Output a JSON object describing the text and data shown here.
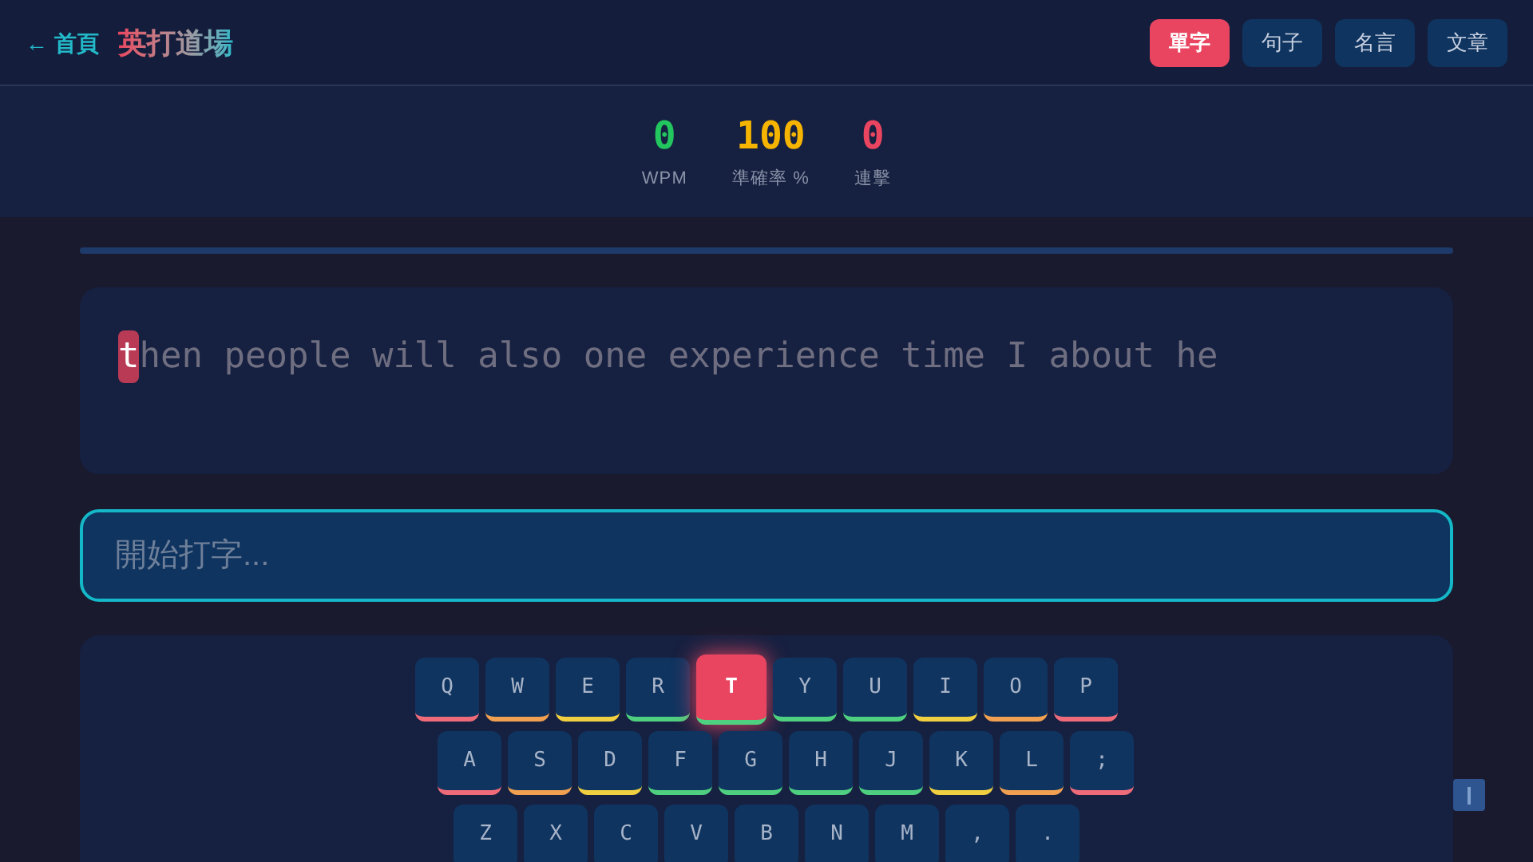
{
  "header": {
    "back_link": "← 首頁",
    "title": "英打道場",
    "modes": [
      {
        "label": "單字",
        "selected": true
      },
      {
        "label": "句子",
        "selected": false
      },
      {
        "label": "名言",
        "selected": false
      },
      {
        "label": "文章",
        "selected": false
      }
    ]
  },
  "stats": [
    {
      "value": "0",
      "label": "WPM",
      "color": "#22c55e"
    },
    {
      "value": "100",
      "label": "準確率 %",
      "color": "#f5b400"
    },
    {
      "value": "0",
      "label": "連擊",
      "color": "#e94560"
    }
  ],
  "target": {
    "current": "t",
    "rest": "hen people will also one experience time I about he"
  },
  "input": {
    "placeholder": "開始打字..."
  },
  "keyboard": {
    "rows": [
      [
        {
          "label": "Q",
          "color": "#f06b7a",
          "selected": false
        },
        {
          "label": "W",
          "color": "#f0a050",
          "selected": false
        },
        {
          "label": "E",
          "color": "#f0d040",
          "selected": false
        },
        {
          "label": "R",
          "color": "#4fd080",
          "selected": false
        },
        {
          "label": "T",
          "color": "#4fd080",
          "selected": true
        },
        {
          "label": "Y",
          "color": "#4fd080",
          "selected": false
        },
        {
          "label": "U",
          "color": "#4fd080",
          "selected": false
        },
        {
          "label": "I",
          "color": "#f0d040",
          "selected": false
        },
        {
          "label": "O",
          "color": "#f0a050",
          "selected": false
        },
        {
          "label": "P",
          "color": "#f06b7a",
          "selected": false
        }
      ],
      [
        {
          "label": "A",
          "color": "#f06b7a",
          "selected": false
        },
        {
          "label": "S",
          "color": "#f0a050",
          "selected": false
        },
        {
          "label": "D",
          "color": "#f0d040",
          "selected": false
        },
        {
          "label": "F",
          "color": "#4fd080",
          "selected": false
        },
        {
          "label": "G",
          "color": "#4fd080",
          "selected": false
        },
        {
          "label": "H",
          "color": "#4fd080",
          "selected": false
        },
        {
          "label": "J",
          "color": "#4fd080",
          "selected": false
        },
        {
          "label": "K",
          "color": "#f0d040",
          "selected": false
        },
        {
          "label": "L",
          "color": "#f0a050",
          "selected": false
        },
        {
          "label": ";",
          "color": "#f06b7a",
          "selected": false
        }
      ],
      [
        {
          "label": "Z",
          "selected": false
        },
        {
          "label": "X",
          "selected": false
        },
        {
          "label": "C",
          "selected": false
        },
        {
          "label": "V",
          "selected": false
        },
        {
          "label": "B",
          "selected": false
        },
        {
          "label": "N",
          "selected": false
        },
        {
          "label": "M",
          "selected": false
        },
        {
          "label": ",",
          "selected": false
        },
        {
          "label": ".",
          "selected": false
        }
      ]
    ]
  }
}
